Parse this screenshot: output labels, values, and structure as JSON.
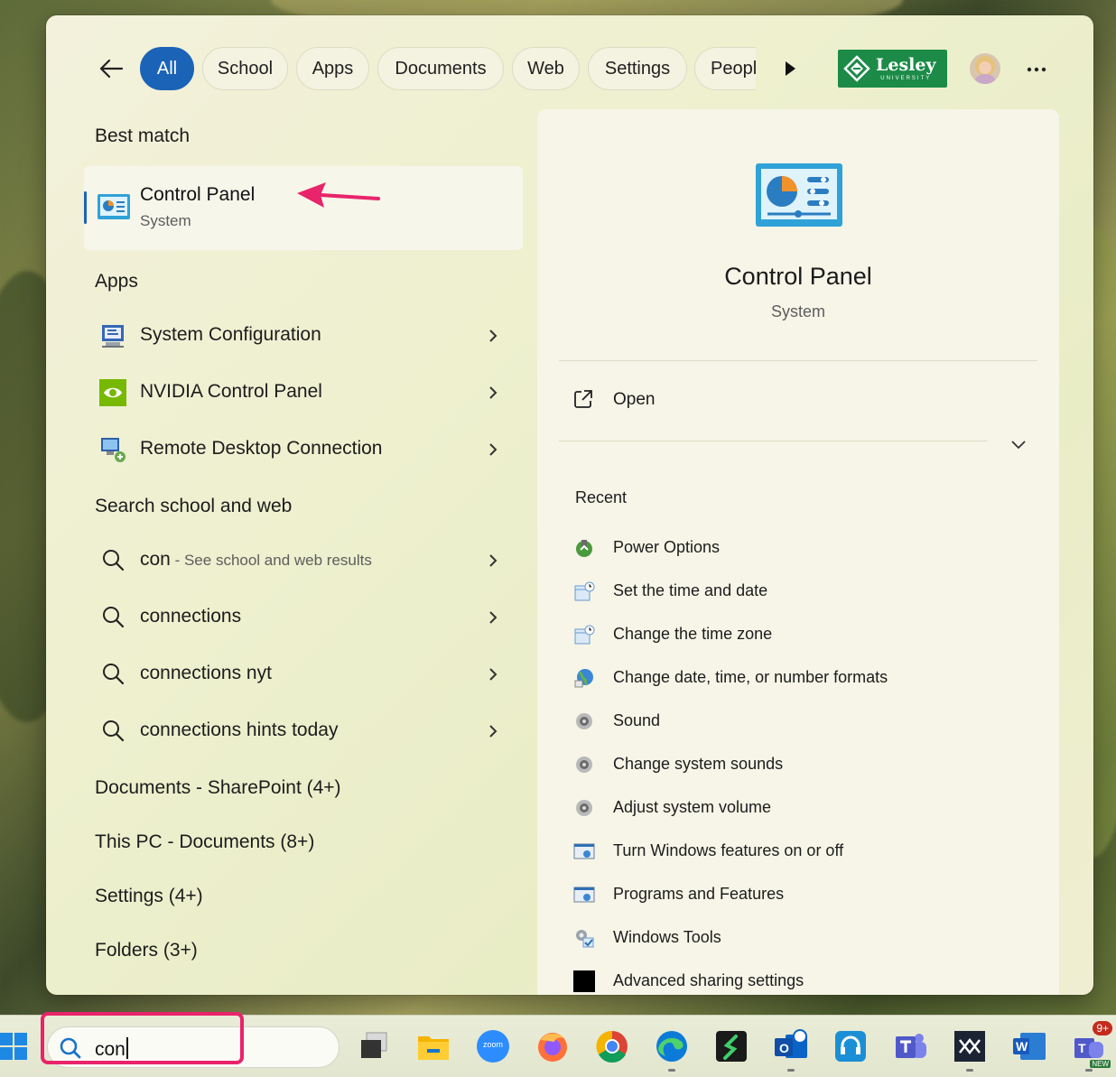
{
  "colors": {
    "accent": "#1b63b7",
    "highlight": "#e8246a",
    "lesley_green": "#1b8b47"
  },
  "header": {
    "filters": [
      {
        "label": "All",
        "active": true
      },
      {
        "label": "School"
      },
      {
        "label": "Apps"
      },
      {
        "label": "Documents"
      },
      {
        "label": "Web"
      },
      {
        "label": "Settings"
      },
      {
        "label": "Peopl"
      }
    ],
    "logo": {
      "text": "Lesley",
      "subtext": "UNIVERSITY"
    },
    "icons": [
      "back-arrow-icon",
      "play-more-icon",
      "avatar",
      "more-icon"
    ]
  },
  "left": {
    "best_match_title": "Best match",
    "best_match": {
      "name": "Control Panel",
      "sub": "System",
      "icon": "control-panel-icon"
    },
    "apps_title": "Apps",
    "apps": [
      {
        "label": "System Configuration",
        "icon": "system-config-icon"
      },
      {
        "label": "NVIDIA Control Panel",
        "icon": "nvidia-icon"
      },
      {
        "label": "Remote Desktop Connection",
        "icon": "remote-desktop-icon"
      }
    ],
    "web_title": "Search school and web",
    "web": [
      {
        "label": "con",
        "sub": " - See school and web results"
      },
      {
        "label": "connections"
      },
      {
        "label": "connections nyt"
      },
      {
        "label": "connections hints today"
      }
    ],
    "groups": [
      "Documents - SharePoint (4+)",
      "This PC - Documents (8+)",
      "Settings (4+)",
      "Folders (3+)"
    ]
  },
  "detail": {
    "title": "Control Panel",
    "sub": "System",
    "open_label": "Open",
    "recent_title": "Recent",
    "recent": [
      {
        "label": "Power Options",
        "icon": "power-options-icon"
      },
      {
        "label": "Set the time and date",
        "icon": "date-time-icon"
      },
      {
        "label": "Change the time zone",
        "icon": "date-time-icon"
      },
      {
        "label": "Change date, time, or number formats",
        "icon": "region-globe-icon"
      },
      {
        "label": "Sound",
        "icon": "speaker-icon"
      },
      {
        "label": "Change system sounds",
        "icon": "speaker-icon"
      },
      {
        "label": "Adjust system volume",
        "icon": "speaker-icon"
      },
      {
        "label": "Turn Windows features on or off",
        "icon": "programs-icon"
      },
      {
        "label": "Programs and Features",
        "icon": "programs-icon"
      },
      {
        "label": "Windows Tools",
        "icon": "windows-tools-icon"
      },
      {
        "label": "Advanced sharing settings",
        "icon": "black-square-icon"
      }
    ]
  },
  "taskbar": {
    "search_value": "con",
    "apps": [
      {
        "name": "task-view-icon"
      },
      {
        "name": "file-explorer-icon"
      },
      {
        "name": "zoom-icon",
        "text": "zoom"
      },
      {
        "name": "firefox-icon"
      },
      {
        "name": "chrome-icon"
      },
      {
        "name": "edge-icon"
      },
      {
        "name": "scribe-icon"
      },
      {
        "name": "outlook-icon",
        "text": "O"
      },
      {
        "name": "support-icon"
      },
      {
        "name": "teams-icon"
      },
      {
        "name": "app-mesh-icon"
      },
      {
        "name": "word-icon",
        "text": "W"
      },
      {
        "name": "teams-new-icon",
        "text": "T",
        "badge": "9+",
        "tag": "NEW"
      }
    ]
  }
}
